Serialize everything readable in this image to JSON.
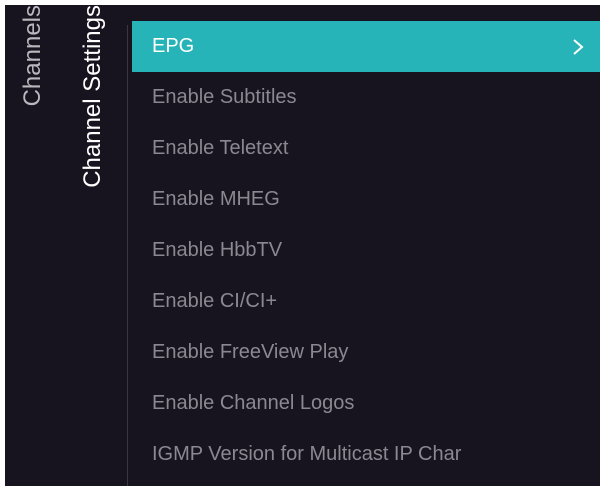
{
  "breadcrumb": {
    "parent": "Channels",
    "current": "Channel Settings"
  },
  "menu": {
    "items": [
      {
        "label": "EPG",
        "selected": true
      },
      {
        "label": "Enable Subtitles"
      },
      {
        "label": "Enable Teletext"
      },
      {
        "label": "Enable MHEG"
      },
      {
        "label": "Enable HbbTV"
      },
      {
        "label": "Enable CI/CI+"
      },
      {
        "label": "Enable FreeView Play"
      },
      {
        "label": "Enable Channel Logos"
      },
      {
        "label": "IGMP Version for Multicast IP Char"
      }
    ],
    "selected_icon": "chevron-right-icon"
  },
  "colors": {
    "background": "#17141f",
    "accent": "#27b4b8",
    "inactive_text": "#8a8891"
  }
}
